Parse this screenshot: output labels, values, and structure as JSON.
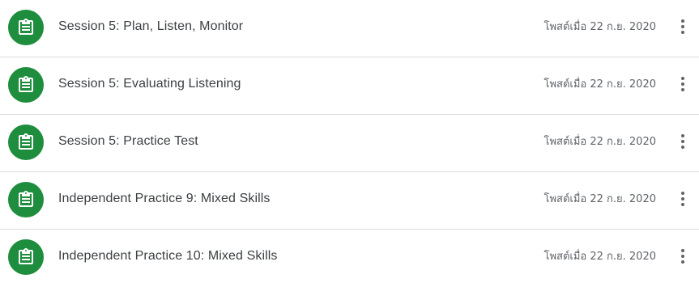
{
  "items": [
    {
      "title": "Session 5: Plan, Listen, Monitor",
      "date": "โพสต์เมื่อ 22 ก.ย. 2020",
      "icon": "assignment-icon"
    },
    {
      "title": "Session 5: Evaluating Listening",
      "date": "โพสต์เมื่อ 22 ก.ย. 2020",
      "icon": "assignment-icon"
    },
    {
      "title": "Session 5: Practice Test",
      "date": "โพสต์เมื่อ 22 ก.ย. 2020",
      "icon": "assignment-icon"
    },
    {
      "title": "Independent Practice 9: Mixed Skills",
      "date": "โพสต์เมื่อ 22 ก.ย. 2020",
      "icon": "assignment-icon"
    },
    {
      "title": "Independent Practice 10: Mixed Skills",
      "date": "โพสต์เมื่อ 22 ก.ย. 2020",
      "icon": "assignment-icon"
    }
  ],
  "colors": {
    "icon_bg": "#1e8e3e",
    "title": "#3c4043",
    "date": "#5f6368",
    "divider": "#dadce0"
  }
}
